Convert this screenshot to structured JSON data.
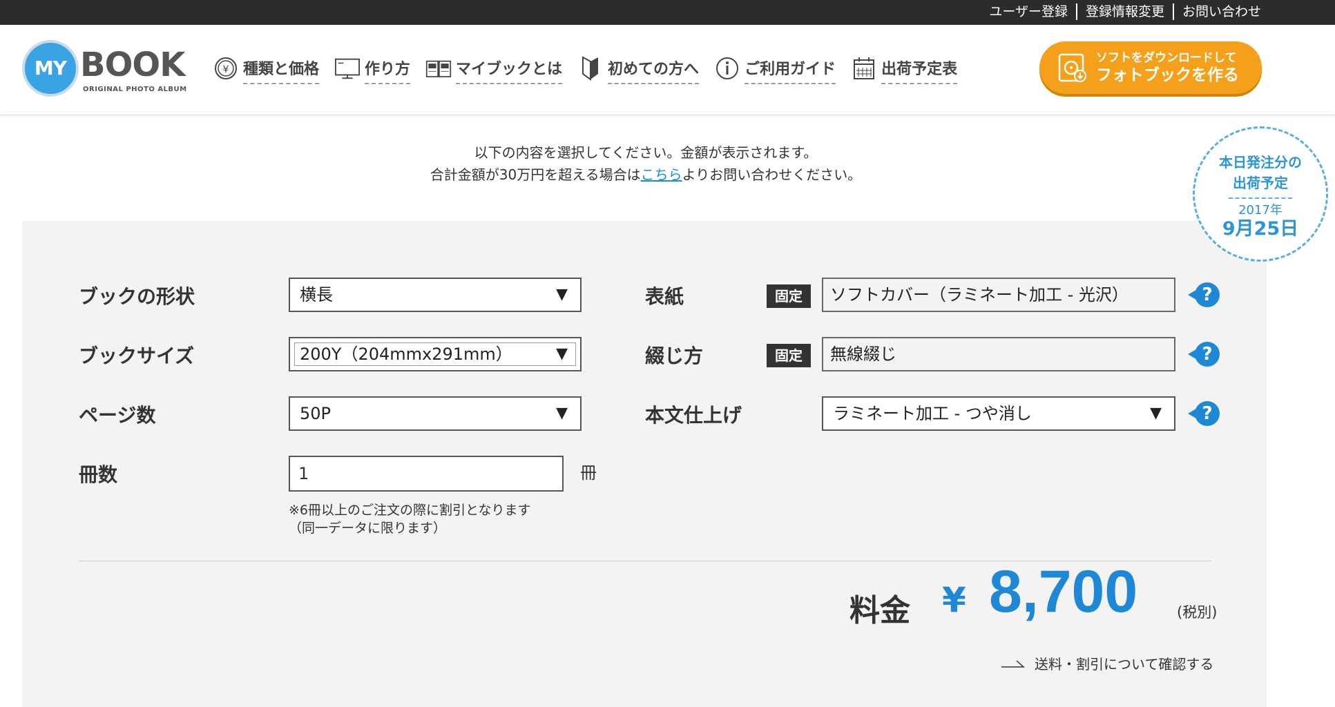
{
  "topbar": {
    "links": [
      "ユーザー登録",
      "登録情報変更",
      "お問い合わせ"
    ]
  },
  "logo": {
    "circle": "MY",
    "word": "BOOK",
    "sub": "ORIGINAL PHOTO ALBUM"
  },
  "nav": {
    "items": [
      {
        "label": "種類と価格",
        "icon": "yen-coin-icon"
      },
      {
        "label": "作り方",
        "icon": "monitor-icon"
      },
      {
        "label": "マイブックとは",
        "icon": "open-book-icon"
      },
      {
        "label": "初めての方へ",
        "icon": "beginner-mark-icon"
      },
      {
        "label": "ご利用ガイド",
        "icon": "info-icon"
      },
      {
        "label": "出荷予定表",
        "icon": "calendar-icon"
      }
    ]
  },
  "download_button": {
    "line1": "ソフトをダウンロードして",
    "line2": "フォトブックを作る"
  },
  "intro": {
    "line1": "以下の内容を選択してください。金額が表示されます。",
    "line2_before": "合計金額が30万円を超える場合は",
    "line2_link": "こちら",
    "line2_after": "よりお問い合わせください。"
  },
  "stamp": {
    "title_line1": "本日発注分の",
    "title_line2": "出荷予定",
    "year": "2017年",
    "date": "9月25日"
  },
  "form": {
    "shape": {
      "label": "ブックの形状",
      "value": "横長"
    },
    "size": {
      "label": "ブックサイズ",
      "value": "200Y（204mmx291mm）"
    },
    "pages": {
      "label": "ページ数",
      "value": "50P"
    },
    "quantity": {
      "label": "冊数",
      "value": "1",
      "unit": "冊"
    },
    "cover": {
      "label": "表紙",
      "badge": "固定",
      "value": "ソフトカバー（ラミネート加工 - 光沢）"
    },
    "binding": {
      "label": "綴じ方",
      "badge": "固定",
      "value": "無線綴じ"
    },
    "finish": {
      "label": "本文仕上げ",
      "value": "ラミネート加工 - つや消し"
    },
    "note_line1": "※6冊以上のご注文の際に割引となります",
    "note_line2": "（同一データに限ります）",
    "arrow_glyph": "▼",
    "help_glyph": "?"
  },
  "price": {
    "label": "料金",
    "currency": "¥",
    "value": "8,700",
    "tax": "(税別)"
  },
  "shipping_link": "送料・割引について確認する",
  "colors": {
    "accent_blue": "#1e88d6",
    "download_orange": "#f5a01a",
    "topbar": "#2c2c2c",
    "panel": "#f3f3f3"
  }
}
